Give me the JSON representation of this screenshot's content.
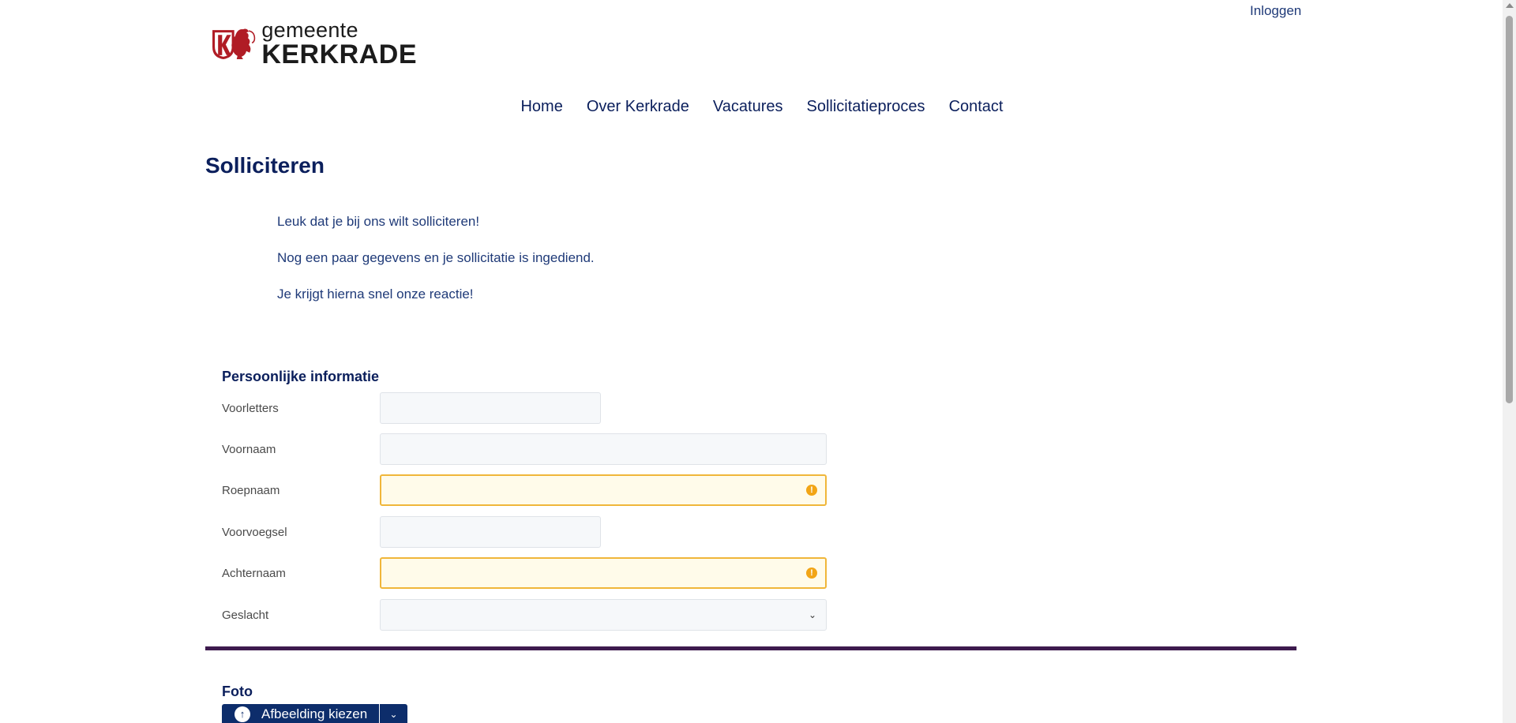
{
  "header": {
    "login_label": "Inloggen",
    "logo": {
      "line1": "gemeente",
      "line2": "KERKRADE",
      "brand_color": "#b01c25"
    }
  },
  "nav": {
    "items": [
      {
        "label": "Home"
      },
      {
        "label": "Over Kerkrade"
      },
      {
        "label": "Vacatures"
      },
      {
        "label": "Sollicitatieproces"
      },
      {
        "label": "Contact"
      }
    ]
  },
  "page": {
    "title": "Solliciteren",
    "intro": [
      "Leuk dat je bij ons wilt solliciteren!",
      "Nog een paar gegevens en je sollicitatie is ingediend.",
      "Je krijgt hierna snel onze reactie!"
    ]
  },
  "personal": {
    "section_title": "Persoonlijke informatie",
    "fields": [
      {
        "label": "Voorletters",
        "value": "",
        "state": "normal"
      },
      {
        "label": "Voornaam",
        "value": "",
        "state": "normal"
      },
      {
        "label": "Roepnaam",
        "value": "",
        "state": "warning"
      },
      {
        "label": "Voorvoegsel",
        "value": "",
        "state": "normal"
      },
      {
        "label": "Achternaam",
        "value": "",
        "state": "warning"
      },
      {
        "label": "Geslacht",
        "value": "",
        "state": "normal",
        "type": "select"
      }
    ],
    "warning_color": "#f2a516"
  },
  "photo": {
    "section_title": "Foto",
    "upload_label": "Afbeelding kiezen",
    "button_color": "#0d2d6b"
  },
  "colors": {
    "divider": "#3d1a4e",
    "text_primary": "#0b1f5c"
  }
}
